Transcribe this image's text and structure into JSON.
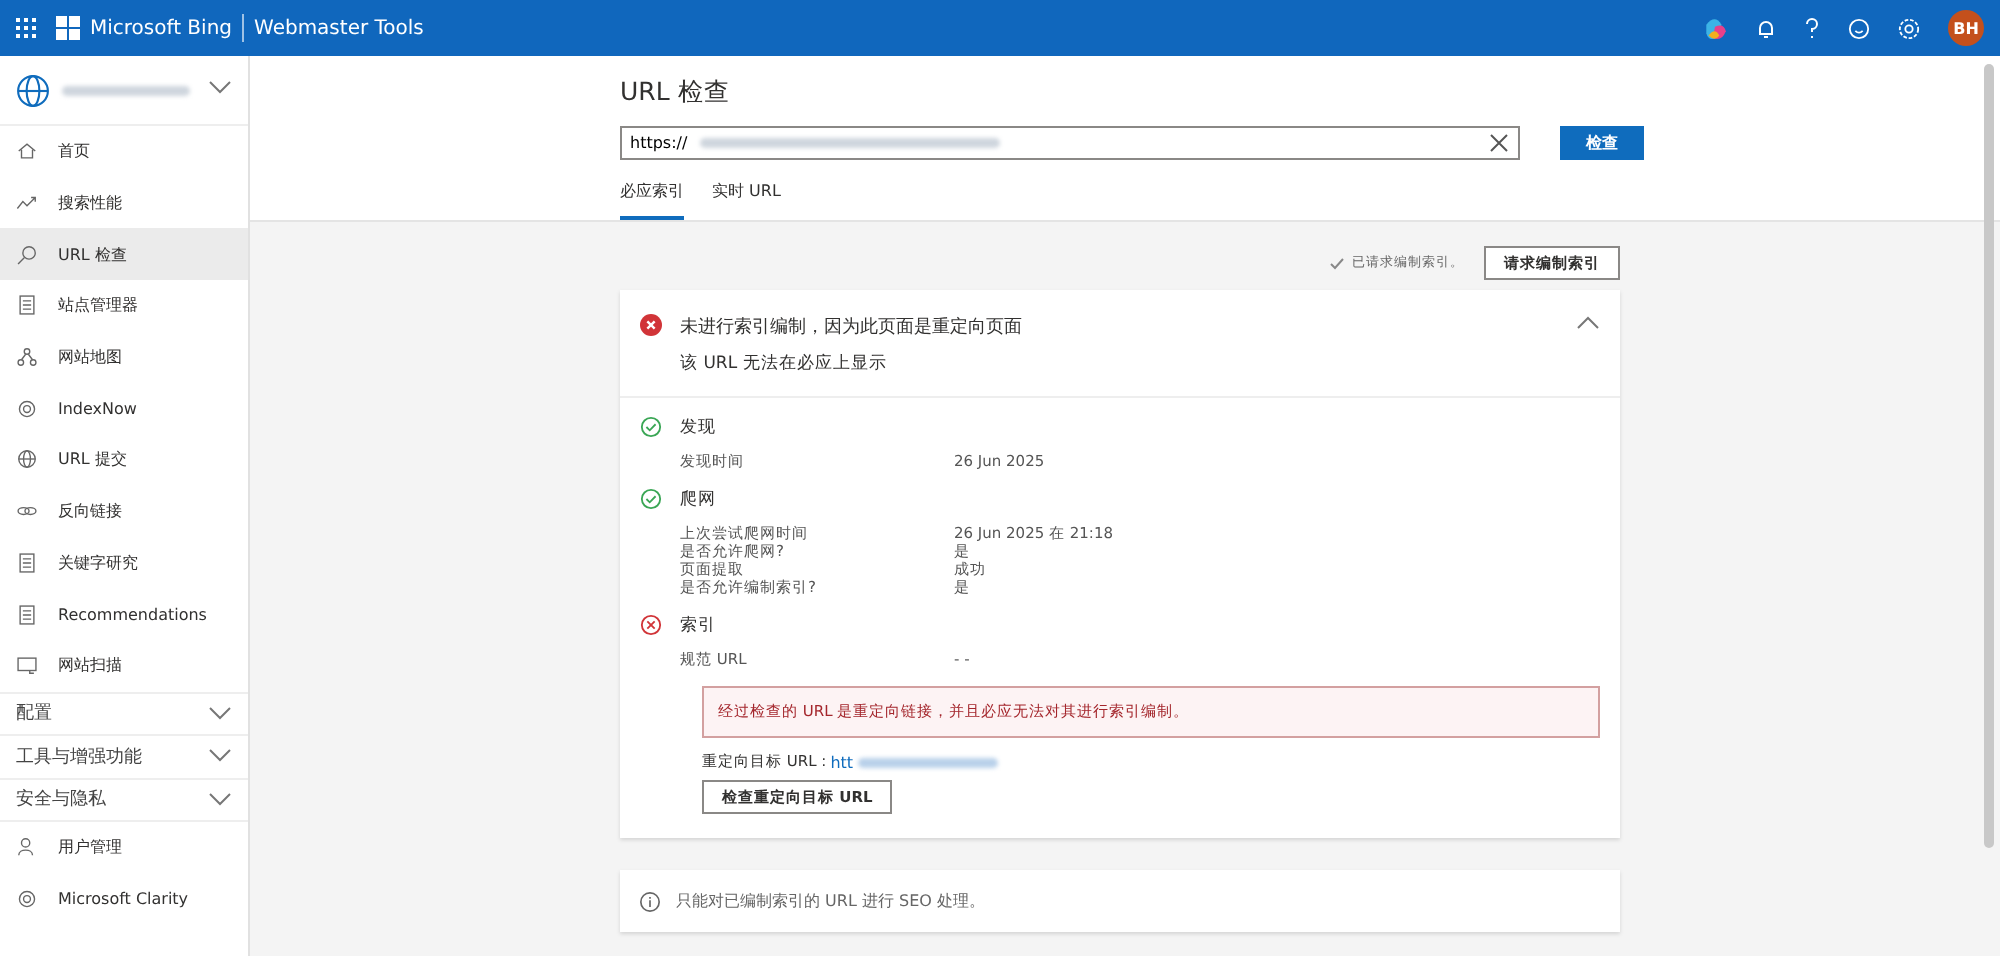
{
  "header": {
    "brand": "Microsoft Bing",
    "product": "Webmaster Tools",
    "avatar": "BH"
  },
  "sidebar": {
    "items": [
      {
        "label": "首页",
        "selected": false
      },
      {
        "label": "搜索性能",
        "selected": false
      },
      {
        "label": "URL 检查",
        "selected": true
      },
      {
        "label": "站点管理器",
        "selected": false
      },
      {
        "label": "网站地图",
        "selected": false
      },
      {
        "label": "IndexNow",
        "selected": false
      },
      {
        "label": "URL 提交",
        "selected": false
      },
      {
        "label": "反向链接",
        "selected": false
      },
      {
        "label": "关键字研究",
        "selected": false
      },
      {
        "label": "Recommendations",
        "selected": false
      },
      {
        "label": "网站扫描",
        "selected": false
      }
    ],
    "sections": [
      {
        "label": "配置",
        "expanded": false
      },
      {
        "label": "工具与增强功能",
        "expanded": false
      },
      {
        "label": "安全与隐私",
        "expanded": false
      }
    ],
    "bottom_items": [
      "用户管理",
      "Microsoft Clarity"
    ]
  },
  "page": {
    "title": "URL 检查",
    "url_field": {
      "value": "https://"
    },
    "inspect_button": "检查",
    "tabs": [
      {
        "label": "必应索引",
        "selected": true
      },
      {
        "label": "实时 URL",
        "selected": false
      }
    ],
    "requested_note": "已请求编制索引。",
    "request_button": "请求编制索引",
    "result": {
      "title": "未进行索引编制，因为此页面是重定向页面",
      "subtitle": "该 URL 无法在必应上显示",
      "expanded": true,
      "sections": [
        {
          "title": "发现",
          "kind": "ok",
          "rows": [
            {
              "label": "发现时间",
              "value": "26 Jun 2025"
            }
          ]
        },
        {
          "title": "爬网",
          "kind": "ok",
          "rows": [
            {
              "label": "上次尝试爬网时间",
              "value": "26 Jun 2025 在 21:18"
            },
            {
              "label": "是否允许爬网?",
              "value": "是"
            },
            {
              "label": "页面提取",
              "value": "成功"
            },
            {
              "label": "是否允许编制索引?",
              "value": "是"
            }
          ]
        },
        {
          "title": "索引",
          "kind": "error",
          "rows": [
            {
              "label": "规范 URL",
              "value": "- -"
            }
          ]
        }
      ],
      "alert": "经过检查的 URL 是重定向链接，并且必应无法对其进行索引编制。",
      "redirect_label": "重定向目标 URL :",
      "redirect_link": "htt",
      "redirect_button": "检查重定向目标 URL"
    },
    "info": "只能对已编制索引的 URL 进行 SEO 处理。"
  }
}
